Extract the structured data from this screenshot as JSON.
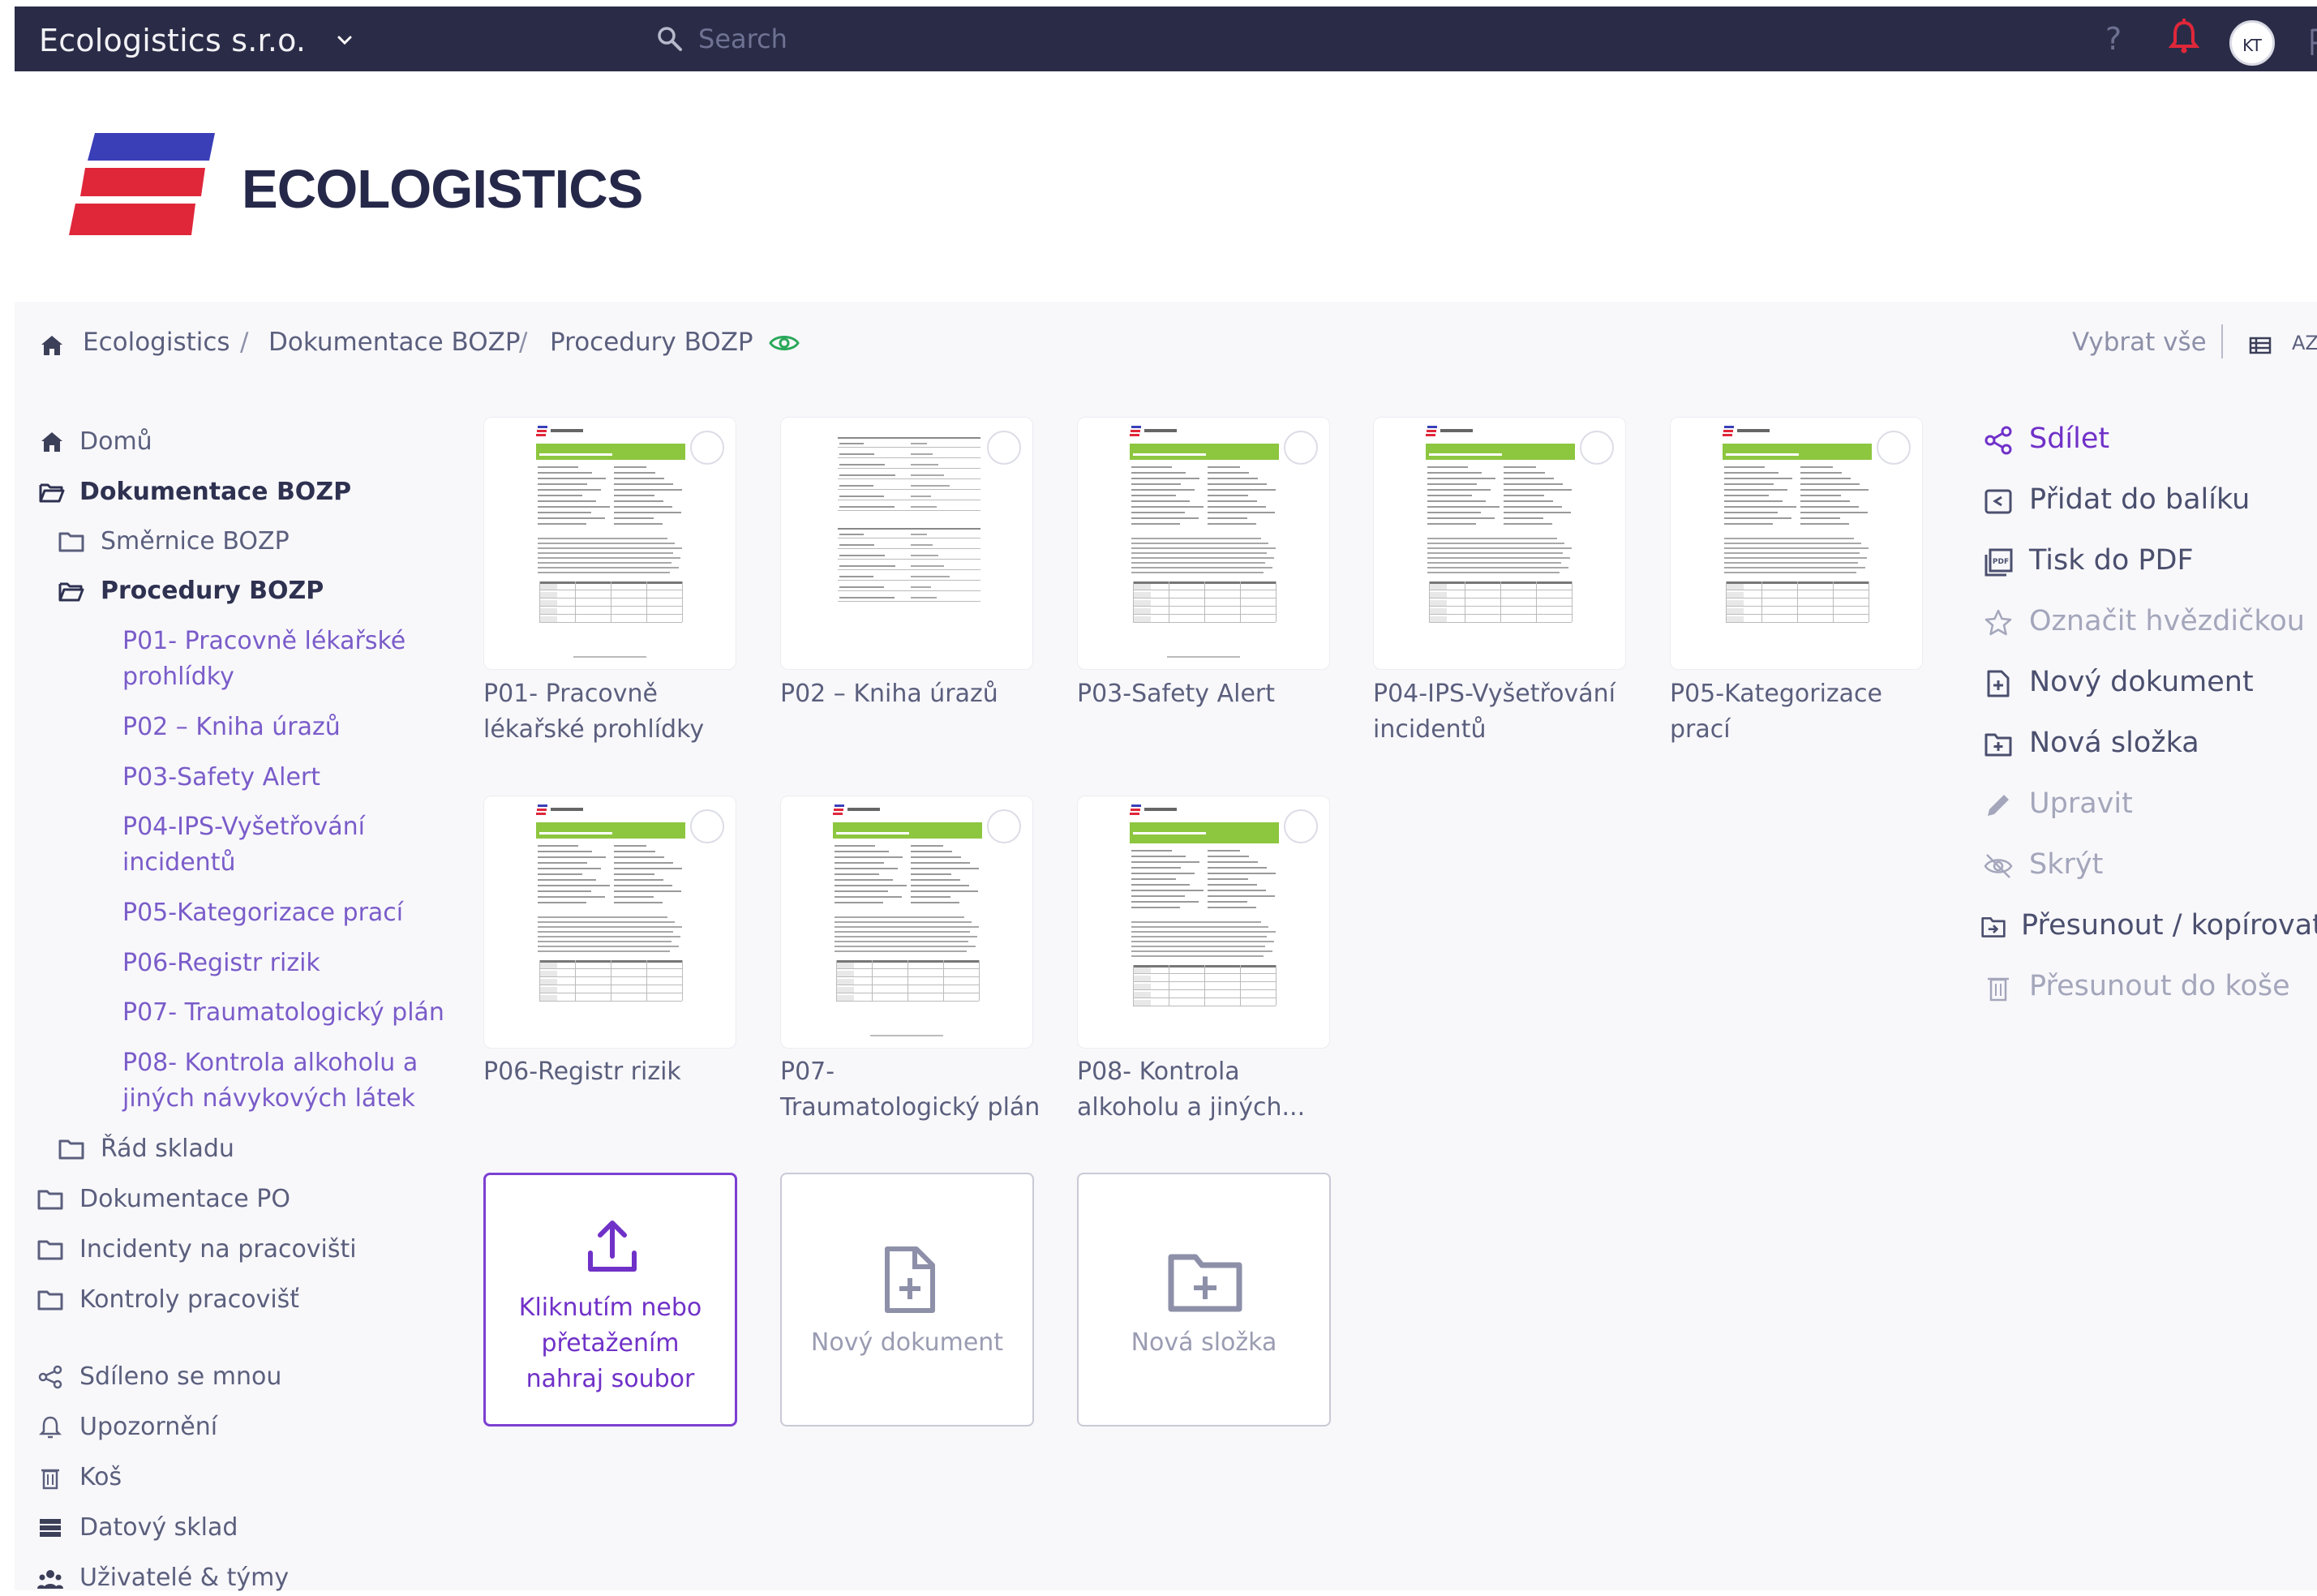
{
  "topbar": {
    "org_name": "Ecologistics s.r.o.",
    "search_placeholder": "Search",
    "help": "?",
    "avatar_initials": "KT",
    "colors": {
      "background": "#2a2c47",
      "alert": "#e0273a"
    }
  },
  "brand": {
    "name": "ECOLOGISTICS"
  },
  "breadcrumb": {
    "items": [
      "Ecologistics",
      "Dokumentace BOZP",
      "Procedury BOZP"
    ],
    "separator": "/",
    "select_all": "Vybrat vše",
    "sort_icon_text": "AZ"
  },
  "sidebar": {
    "home": "Domů",
    "dok_bozp": "Dokumentace BOZP",
    "smernice": "Směrnice BOZP",
    "procedury": "Procedury BOZP",
    "procedures": [
      [
        "P01- Pracovně lékařské",
        "prohlídky"
      ],
      [
        "P02 – Kniha úrazů"
      ],
      [
        "P03-Safety Alert"
      ],
      [
        "P04-IPS-Vyšetřování",
        "incidentů"
      ],
      [
        "P05-Kategorizace prací"
      ],
      [
        "P06-Registr rizik"
      ],
      [
        "P07- Traumatologický plán"
      ],
      [
        "P08- Kontrola alkoholu a",
        "jiných návykových látek"
      ]
    ],
    "rad_skladu": "Řád skladu",
    "dok_po": "Dokumentace PO",
    "incidenty": "Incidenty na pracovišti",
    "kontroly": "Kontroly pracovišť",
    "shared": "Sdíleno se mnou",
    "notifications": "Upozornění",
    "trash": "Koš",
    "data_store": "Datový sklad",
    "users": "Uživatelé & týmy"
  },
  "documents": [
    {
      "line1": "P01- Pracovně",
      "line2": "lékařské prohlídky"
    },
    {
      "line1": "P02 – Kniha úrazů",
      "line2": ""
    },
    {
      "line1": "P03-Safety Alert",
      "line2": ""
    },
    {
      "line1": "P04-IPS-Vyšetřování",
      "line2": "incidentů"
    },
    {
      "line1": "P05-Kategorizace",
      "line2": "prací"
    },
    {
      "line1": "P06-Registr rizik",
      "line2": ""
    },
    {
      "line1": "P07-",
      "line2": "Traumatologický plán"
    },
    {
      "line1": "P08- Kontrola",
      "line2": "alkoholu a jiných..."
    }
  ],
  "tiles": {
    "upload": [
      "Kliknutím nebo",
      "přetažením",
      "nahraj soubor"
    ],
    "new_doc": "Nový dokument",
    "new_folder": "Nová složka"
  },
  "actions": [
    {
      "label": "Sdílet",
      "icon": "share-icon",
      "state": "accent"
    },
    {
      "label": "Přidat do balíku",
      "icon": "package-icon",
      "state": "normal"
    },
    {
      "label": "Tisk do PDF",
      "icon": "pdf-icon",
      "state": "normal"
    },
    {
      "label": "Označit hvězdičkou",
      "icon": "star-icon",
      "state": "disabled"
    },
    {
      "label": "Nový dokument",
      "icon": "new-document-icon",
      "state": "normal"
    },
    {
      "label": "Nová složka",
      "icon": "new-folder-icon",
      "state": "normal"
    },
    {
      "label": "Upravit",
      "icon": "pencil-icon",
      "state": "disabled"
    },
    {
      "label": "Skrýt",
      "icon": "eye-off-icon",
      "state": "disabled"
    },
    {
      "label": "Přesunout / kopírovat",
      "icon": "move-icon",
      "state": "normal"
    },
    {
      "label": "Přesunout do koše",
      "icon": "trash-icon",
      "state": "disabled"
    }
  ],
  "colors": {
    "accent": "#7031c8",
    "eye_green": "#2aa85a",
    "doc_green": "#8dc63f",
    "logo_blue": "#3a3fb8",
    "logo_red": "#e0273a"
  }
}
